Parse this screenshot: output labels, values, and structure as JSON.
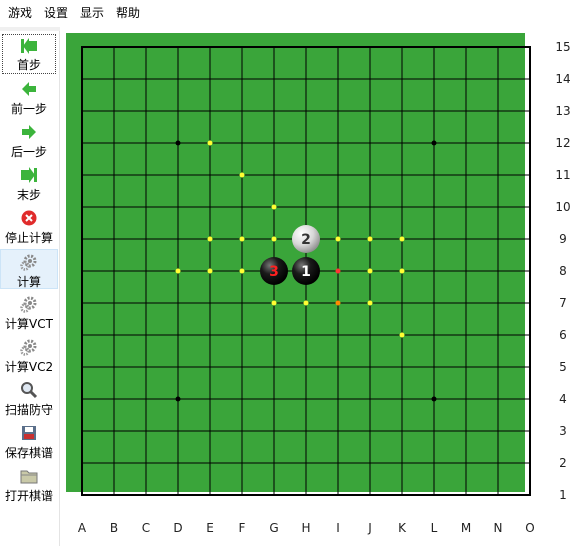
{
  "menu": {
    "items": [
      "游戏",
      "设置",
      "显示",
      "帮助"
    ]
  },
  "toolbar": {
    "items": [
      {
        "label": "首步",
        "icon": "first-step-icon"
      },
      {
        "label": "前一步",
        "icon": "prev-step-icon"
      },
      {
        "label": "后一步",
        "icon": "next-step-icon"
      },
      {
        "label": "末步",
        "icon": "last-step-icon"
      },
      {
        "label": "停止计算",
        "icon": "stop-icon"
      },
      {
        "label": "计算",
        "icon": "gear-icon"
      },
      {
        "label": "计算VCT",
        "icon": "gear-icon"
      },
      {
        "label": "计算VC2",
        "icon": "gear-icon"
      },
      {
        "label": "扫描防守",
        "icon": "magnifier-icon"
      },
      {
        "label": "保存棋谱",
        "icon": "save-icon"
      },
      {
        "label": "打开棋谱",
        "icon": "folder-icon"
      }
    ]
  },
  "board": {
    "columns": [
      "A",
      "B",
      "C",
      "D",
      "E",
      "F",
      "G",
      "H",
      "I",
      "J",
      "K",
      "L",
      "M",
      "N",
      "O"
    ],
    "rows": [
      "15",
      "14",
      "13",
      "12",
      "11",
      "10",
      "9",
      "8",
      "7",
      "6",
      "5",
      "4",
      "3",
      "2",
      "1"
    ],
    "colors": {
      "frame": "#3aa53a",
      "grid": "#000000",
      "hint": "#ffff33",
      "last": "#ff3333",
      "alt": "#ff8a00"
    },
    "stones": [
      {
        "col": "H",
        "row": 8,
        "color": "black",
        "number": "1"
      },
      {
        "col": "H",
        "row": 9,
        "color": "white",
        "number": "2"
      },
      {
        "col": "G",
        "row": 8,
        "color": "black",
        "number": "3"
      }
    ],
    "star_points": [
      [
        "D",
        12
      ],
      [
        "L",
        12
      ],
      [
        "D",
        4
      ],
      [
        "L",
        4
      ]
    ],
    "hint_points": [
      [
        "E",
        12
      ],
      [
        "F",
        11
      ],
      [
        "G",
        10
      ],
      [
        "E",
        9
      ],
      [
        "F",
        9
      ],
      [
        "G",
        9
      ],
      [
        "I",
        9
      ],
      [
        "J",
        9
      ],
      [
        "K",
        9
      ],
      [
        "D",
        8
      ],
      [
        "E",
        8
      ],
      [
        "F",
        8
      ],
      [
        "J",
        8
      ],
      [
        "K",
        8
      ],
      [
        "G",
        7
      ],
      [
        "H",
        7
      ],
      [
        "J",
        7
      ],
      [
        "K",
        6
      ]
    ],
    "red_points": [
      [
        "I",
        8
      ]
    ],
    "orange_points": [
      [
        "I",
        7
      ]
    ]
  }
}
